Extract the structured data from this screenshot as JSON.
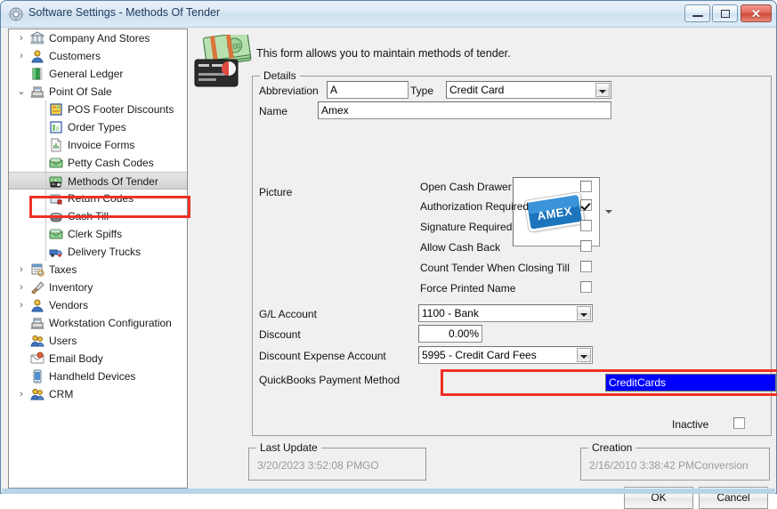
{
  "window": {
    "title": "Software Settings - Methods Of Tender",
    "icon": "settings-gear-icon",
    "controls": {
      "minimize": "Minimize",
      "maximize": "Maximize",
      "close": "✕"
    }
  },
  "sidebar": {
    "items": [
      {
        "label": "Company And Stores",
        "level": 0,
        "expander": "›",
        "icon": "bank-building-icon",
        "selected": false
      },
      {
        "label": "Customers",
        "level": 0,
        "expander": "›",
        "icon": "customer-person-icon",
        "selected": false
      },
      {
        "label": "General Ledger",
        "level": 0,
        "expander": "",
        "icon": "green-book-icon",
        "selected": false
      },
      {
        "label": "Point Of Sale",
        "level": 0,
        "expander": "⌄",
        "icon": "pos-register-icon",
        "selected": false
      },
      {
        "label": "POS Footer Discounts",
        "level": 1,
        "expander": "",
        "icon": "yellow-note-icon",
        "selected": false
      },
      {
        "label": "Order Types",
        "level": 1,
        "expander": "",
        "icon": "order-form-icon",
        "selected": false
      },
      {
        "label": "Invoice Forms",
        "level": 1,
        "expander": "",
        "icon": "invoice-icon",
        "selected": false
      },
      {
        "label": "Petty Cash Codes",
        "level": 1,
        "expander": "",
        "icon": "cash-envelope-icon",
        "selected": false
      },
      {
        "label": "Methods Of Tender",
        "level": 1,
        "expander": "",
        "icon": "tender-cash-card-icon",
        "selected": true
      },
      {
        "label": "Return Codes",
        "level": 1,
        "expander": "",
        "icon": "return-box-icon",
        "selected": false
      },
      {
        "label": "Cash Till",
        "level": 1,
        "expander": "",
        "icon": "cash-till-icon",
        "selected": false
      },
      {
        "label": "Clerk Spiffs",
        "level": 1,
        "expander": "",
        "icon": "cash-envelope-icon",
        "selected": false
      },
      {
        "label": "Delivery Trucks",
        "level": 1,
        "expander": "",
        "icon": "delivery-truck-icon",
        "selected": false
      },
      {
        "label": "Taxes",
        "level": 0,
        "expander": "›",
        "icon": "taxes-icon",
        "selected": false
      },
      {
        "label": "Inventory",
        "level": 0,
        "expander": "›",
        "icon": "inventory-brush-icon",
        "selected": false
      },
      {
        "label": "Vendors",
        "level": 0,
        "expander": "›",
        "icon": "vendor-person-icon",
        "selected": false
      },
      {
        "label": "Workstation Configuration",
        "level": 0,
        "expander": "",
        "icon": "workstation-icon",
        "selected": false
      },
      {
        "label": "Users",
        "level": 0,
        "expander": "",
        "icon": "users-icon",
        "selected": false
      },
      {
        "label": "Email Body",
        "level": 0,
        "expander": "",
        "icon": "email-icon",
        "selected": false
      },
      {
        "label": "Handheld Devices",
        "level": 0,
        "expander": "",
        "icon": "handheld-device-icon",
        "selected": false
      },
      {
        "label": "CRM",
        "level": 0,
        "expander": "›",
        "icon": "crm-users-icon",
        "selected": false
      }
    ]
  },
  "header": {
    "icon": "cash-and-credit-card-icon",
    "description": "This form allows you to maintain methods of tender."
  },
  "details": {
    "group_title": "Details",
    "abbreviation_label": "Abbreviation",
    "abbreviation_value": "A",
    "type_label": "Type",
    "type_value": "Credit Card",
    "name_label": "Name",
    "name_value": "Amex",
    "picture_label": "Picture",
    "picture_image": "amex-card-logo",
    "checkboxes": [
      {
        "label": "Open Cash Drawer",
        "checked": false
      },
      {
        "label": "Authorization Required",
        "checked": true
      },
      {
        "label": "Signature Required",
        "checked": false
      },
      {
        "label": "Allow Cash Back",
        "checked": false
      },
      {
        "label": "Count Tender When Closing Till",
        "checked": false
      },
      {
        "label": "Force Printed Name",
        "checked": false
      }
    ],
    "gl_account_label": "G/L Account",
    "gl_account_value": "1100 - Bank",
    "discount_label": "Discount",
    "discount_value": "0.00%",
    "discount_expense_label": "Discount Expense Account",
    "discount_expense_value": "5995 - Credit Card Fees",
    "quickbooks_label": "QuickBooks Payment Method",
    "quickbooks_value": "CreditCards",
    "inactive_label": "Inactive",
    "inactive_checked": false
  },
  "last_update": {
    "group_title": "Last Update",
    "timestamp": "3/20/2023 3:52:08 PM",
    "user": "GO"
  },
  "creation": {
    "group_title": "Creation",
    "timestamp": "2/16/2010 3:38:42 PM",
    "user": "Conversion"
  },
  "footer": {
    "ok_label": "OK",
    "cancel_label": "Cancel"
  },
  "colors": {
    "annotation_red": "#ee3124",
    "selection_blue": "#0000ff",
    "titlebar_blue": "#cfe0ef",
    "close_red": "#cf4a38"
  }
}
